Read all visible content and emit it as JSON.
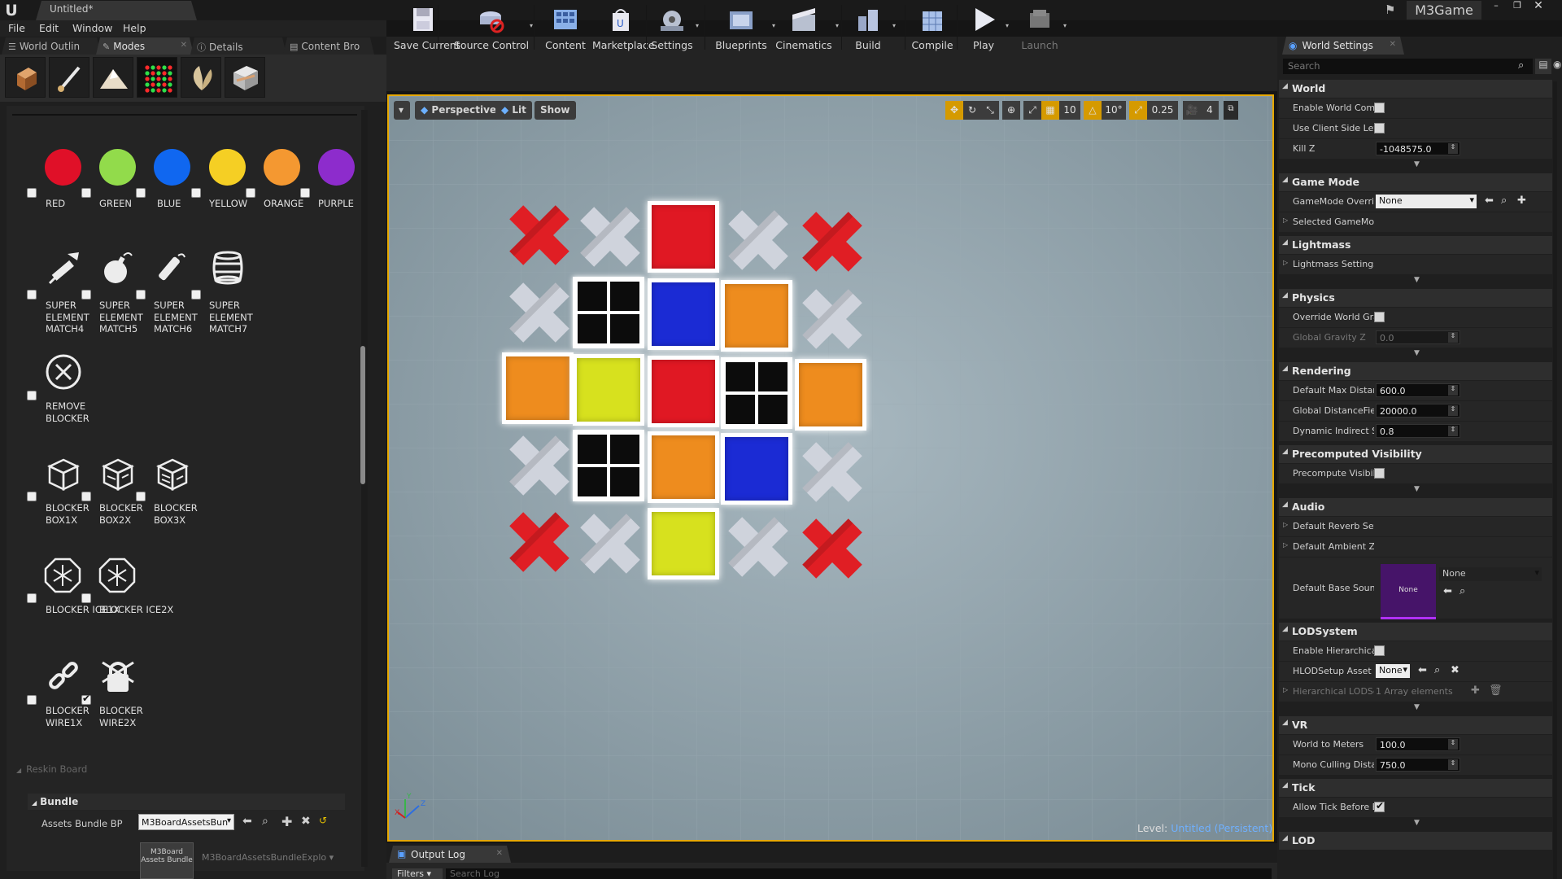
{
  "titlebar": {
    "doc_tab": "Untitled*",
    "project": "M3Game"
  },
  "menu": [
    "File",
    "Edit",
    "Window",
    "Help"
  ],
  "left_tabs": [
    {
      "label": "World Outlin"
    },
    {
      "label": "Modes"
    },
    {
      "label": "Details"
    },
    {
      "label": "Content Bro"
    }
  ],
  "colors": [
    {
      "label": "RED",
      "color": "#e01028"
    },
    {
      "label": "GREEN",
      "color": "#92db4b"
    },
    {
      "label": "BLUE",
      "color": "#1067f0"
    },
    {
      "label": "YELLOW",
      "color": "#f5cf24"
    },
    {
      "label": "ORANGE",
      "color": "#f49831"
    },
    {
      "label": "PURPLE",
      "color": "#8d2ccc"
    }
  ],
  "super_items": [
    {
      "l1": "SUPER",
      "l2": "ELEMENT",
      "l3": "MATCH4",
      "icon": "firecracker-icon"
    },
    {
      "l1": "SUPER",
      "l2": "ELEMENT",
      "l3": "MATCH5",
      "icon": "bomb-icon"
    },
    {
      "l1": "SUPER",
      "l2": "ELEMENT",
      "l3": "MATCH6",
      "icon": "dynamite-icon"
    },
    {
      "l1": "SUPER",
      "l2": "ELEMENT",
      "l3": "MATCH7",
      "icon": "barrel-icon"
    }
  ],
  "remove_blocker": {
    "l1": "REMOVE",
    "l2": "BLOCKER"
  },
  "blocker_boxes": [
    {
      "l1": "BLOCKER",
      "l2": "BOX1X"
    },
    {
      "l1": "BLOCKER",
      "l2": "BOX2X"
    },
    {
      "l1": "BLOCKER",
      "l2": "BOX3X"
    }
  ],
  "blocker_ice": [
    {
      "label": "BLOCKER ICE1X"
    },
    {
      "label": "BLOCKER ICE2X"
    }
  ],
  "blocker_wire": [
    {
      "l1": "BLOCKER",
      "l2": "WIRE1X",
      "checked": false
    },
    {
      "l1": "BLOCKER",
      "l2": "WIRE2X",
      "checked": true
    }
  ],
  "reskin_label": "Reskin Board",
  "bundle": {
    "header": "Bundle",
    "label": "Assets Bundle BP",
    "value": "M3BoardAssetsBun",
    "thumb_l1": "M3Board",
    "thumb_l2": "Assets Bundle",
    "explorer": "M3BoardAssetsBundleExplo"
  },
  "toolbar": [
    {
      "label": "Save Current",
      "icon": "save-icon",
      "arrow": false
    },
    {
      "label": "Source Control",
      "icon": "source-control-icon",
      "arrow": true
    },
    {
      "label": "Content",
      "icon": "content-icon",
      "arrow": false
    },
    {
      "label": "Marketplace",
      "icon": "marketplace-icon",
      "arrow": false
    },
    {
      "label": "Settings",
      "icon": "settings-icon",
      "arrow": true
    },
    {
      "label": "Blueprints",
      "icon": "blueprints-icon",
      "arrow": true
    },
    {
      "label": "Cinematics",
      "icon": "cinematics-icon",
      "arrow": true
    },
    {
      "label": "Build",
      "icon": "build-icon",
      "arrow": true
    },
    {
      "label": "Compile",
      "icon": "compile-icon",
      "arrow": false
    },
    {
      "label": "Play",
      "icon": "play-icon",
      "arrow": true
    },
    {
      "label": "Launch",
      "icon": "launch-icon",
      "arrow": true
    }
  ],
  "viewport": {
    "perspective": "Perspective",
    "lit": "Lit",
    "show": "Show",
    "grid_snap": "10",
    "rot_snap": "10°",
    "scale_snap": "0.25",
    "cam_speed": "4",
    "level_prefix": "Level:",
    "level_name": "Untitled (Persistent)"
  },
  "board": {
    "cells": [
      "X",
      "x",
      "R",
      "x",
      "X",
      "x",
      "B4",
      "B",
      "O",
      "x",
      "O",
      "Y",
      "R",
      "B4",
      "O",
      "x",
      "B4",
      "O",
      "B",
      "x",
      "X",
      "x",
      "Y",
      "x",
      "X"
    ]
  },
  "output_log": {
    "tab": "Output Log",
    "filters": "Filters ▾",
    "search_placeholder": "Search Log"
  },
  "world_settings": {
    "tab": "World Settings",
    "search_placeholder": "Search",
    "sections": [
      {
        "title": "World",
        "rows": [
          {
            "label": "Enable World Compo",
            "type": "check",
            "checked": false
          },
          {
            "label": "Use Client Side Leve",
            "type": "check",
            "checked": false
          },
          {
            "label": "Kill Z",
            "type": "num",
            "value": "-1048575.0"
          }
        ]
      },
      {
        "title": "Game Mode",
        "rows": [
          {
            "label": "GameMode Overrid",
            "type": "drop",
            "value": "None"
          },
          {
            "label": "Selected GameMod",
            "type": "expand"
          }
        ]
      },
      {
        "title": "Lightmass",
        "rows": [
          {
            "label": "Lightmass Settings",
            "type": "expand"
          }
        ]
      },
      {
        "title": "Physics",
        "rows": [
          {
            "label": "Override World Grav",
            "type": "check",
            "checked": false
          },
          {
            "label": "Global Gravity Z",
            "type": "num",
            "value": "0.0",
            "dim": true
          }
        ]
      },
      {
        "title": "Rendering",
        "rows": [
          {
            "label": "Default Max Distanc",
            "type": "num",
            "value": "600.0"
          },
          {
            "label": "Global DistanceFiel",
            "type": "num",
            "value": "20000.0"
          },
          {
            "label": "Dynamic Indirect Sh",
            "type": "num",
            "value": "0.8"
          }
        ]
      },
      {
        "title": "Precomputed Visibility",
        "rows": [
          {
            "label": "Precompute Visibili",
            "type": "check",
            "checked": false
          }
        ]
      },
      {
        "title": "Audio",
        "rows": [
          {
            "label": "Default Reverb Sett",
            "type": "expand"
          },
          {
            "label": "Default Ambient Zo",
            "type": "expand"
          },
          {
            "label": "Default Base Sound",
            "type": "sound",
            "value": "None",
            "thumb": "None"
          }
        ]
      },
      {
        "title": "LODSystem",
        "rows": [
          {
            "label": "Enable Hierarchical",
            "type": "check",
            "checked": false
          },
          {
            "label": "HLODSetup Asset",
            "type": "drop",
            "value": "None"
          },
          {
            "label": "Hierarchical LODSe",
            "type": "array",
            "value": "1 Array elements"
          }
        ]
      },
      {
        "title": "VR",
        "rows": [
          {
            "label": "World to Meters",
            "type": "num",
            "value": "100.0"
          },
          {
            "label": "Mono Culling Distan",
            "type": "num",
            "value": "750.0"
          }
        ]
      },
      {
        "title": "Tick",
        "rows": [
          {
            "label": "Allow Tick Before B",
            "type": "check",
            "checked": true
          }
        ]
      },
      {
        "title": "LOD",
        "rows": []
      }
    ]
  }
}
